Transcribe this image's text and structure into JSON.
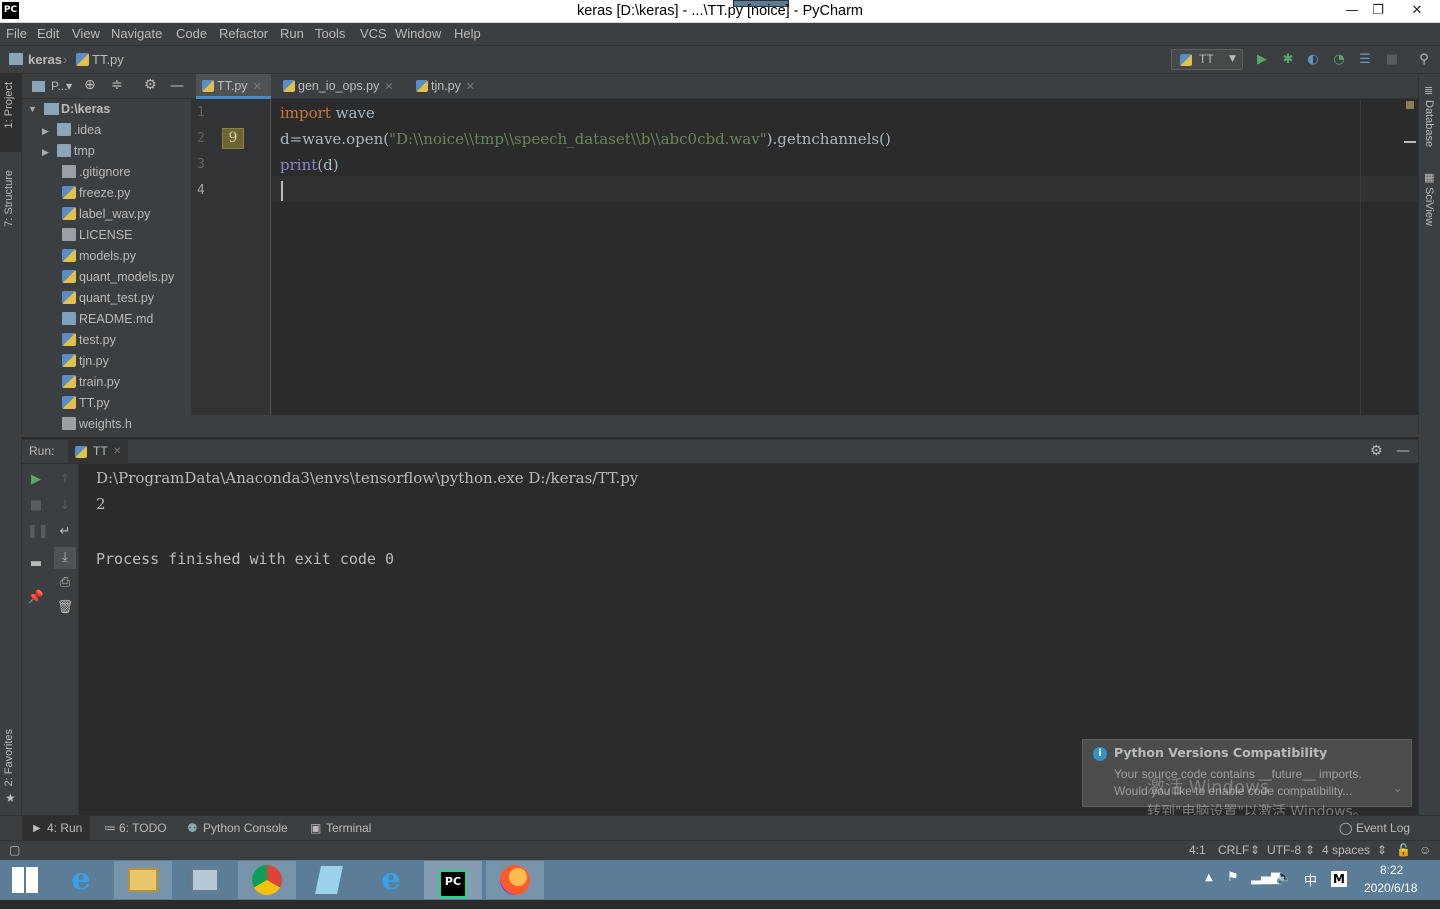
{
  "window": {
    "title": "keras [D:\\keras] - ...\\TT.py [noice] - PyCharm",
    "logo": "PC",
    "minimize": "—",
    "restore": "❐",
    "close": "✕"
  },
  "menu": [
    "File",
    "Edit",
    "View",
    "Navigate",
    "Code",
    "Refactor",
    "Run",
    "Tools",
    "VCS",
    "Window",
    "Help"
  ],
  "breadcrumb": {
    "project": "keras",
    "file": "TT.py"
  },
  "run_config": {
    "name": "TT"
  },
  "left_stripe": {
    "project": "1: Project",
    "structure": "7: Structure",
    "favorites": "2: Favorites"
  },
  "right_stripe": {
    "database": "Database",
    "sciview": "SciView"
  },
  "project_panel": {
    "title": "P...",
    "root": "D:\\keras",
    "items": [
      {
        "name": ".idea",
        "type": "folder"
      },
      {
        "name": "tmp",
        "type": "folder"
      },
      {
        "name": ".gitignore",
        "type": "text"
      },
      {
        "name": "freeze.py",
        "type": "python"
      },
      {
        "name": "label_wav.py",
        "type": "python"
      },
      {
        "name": "LICENSE",
        "type": "text"
      },
      {
        "name": "models.py",
        "type": "python"
      },
      {
        "name": "quant_models.py",
        "type": "python"
      },
      {
        "name": "quant_test.py",
        "type": "python"
      },
      {
        "name": "README.md",
        "type": "markdown"
      },
      {
        "name": "test.py",
        "type": "python"
      },
      {
        "name": "tjn.py",
        "type": "python"
      },
      {
        "name": "train.py",
        "type": "python"
      },
      {
        "name": "TT.py",
        "type": "python"
      },
      {
        "name": "weights.h",
        "type": "text"
      }
    ]
  },
  "editor_tabs": [
    {
      "label": "TT.py",
      "active": true
    },
    {
      "label": "gen_io_ops.py",
      "active": false
    },
    {
      "label": "tjn.py",
      "active": false
    }
  ],
  "editor": {
    "line_numbers": [
      "1",
      "2",
      "3",
      "4"
    ],
    "bookmark": "9",
    "lines": {
      "l1_kw": "import",
      "l1_rest": " wave",
      "l2_pre": "d=wave.open(",
      "l2_str": "\"D:\\\\noice\\\\tmp\\\\speech_dataset\\\\b\\\\abc0cbd.wav\"",
      "l2_post": ").getnchannels()",
      "l3_fn": "print",
      "l3_rest": "(d)"
    }
  },
  "run_panel": {
    "label": "Run:",
    "tab": "TT",
    "output": [
      "D:\\ProgramData\\Anaconda3\\envs\\tensorflow\\python.exe D:/keras/TT.py",
      "2",
      "",
      "Process finished with exit code 0"
    ]
  },
  "notification": {
    "title": "Python Versions Compatibility",
    "line1": "Your source code contains __future__ imports.",
    "line2": "Would you like to enable code compatibility...",
    "watermark1": "激活 Windows",
    "watermark2": "转到\"电脑设置\"以激活 Windows。"
  },
  "bottom_tabs": {
    "run": "4: Run",
    "todo": "6: TODO",
    "python_console": "Python Console",
    "terminal": "Terminal",
    "event_log": "Event Log"
  },
  "status": {
    "position": "4:1",
    "line_sep": "CRLF",
    "encoding": "UTF-8",
    "indent": "4 spaces"
  },
  "taskbar": {
    "time": "8:22",
    "date": "2020/6/18",
    "ime": "中",
    "ime2": "M"
  }
}
